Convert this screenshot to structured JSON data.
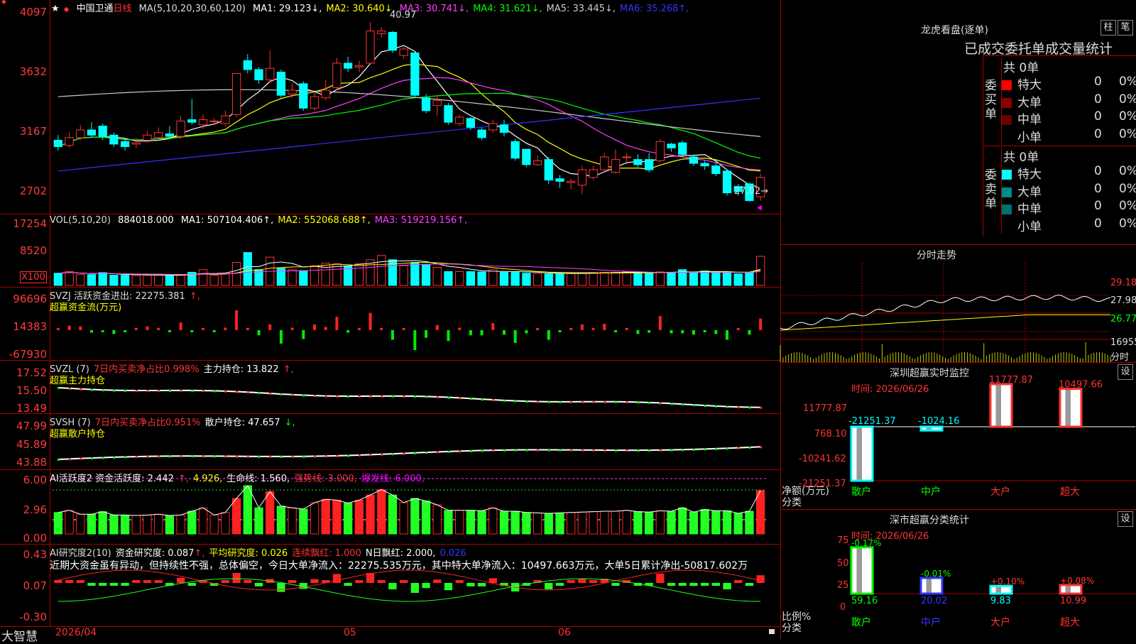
{
  "top_icons": {
    "left_glyph": "◆",
    "right_glyph": "◆"
  },
  "price_pane": {
    "stock": "中国卫通",
    "period": "日线",
    "ma_params": "MA(5,10,20,30,60,120)",
    "ma_values": [
      {
        "label": "MA1: 29.123",
        "arrow": "↓",
        "color": "#ffffff"
      },
      {
        "label": "MA2: 30.640",
        "arrow": "↓",
        "color": "#ffff00"
      },
      {
        "label": "MA3: 30.741",
        "arrow": "↓",
        "color": "#ff40ff"
      },
      {
        "label": "MA4: 31.621",
        "arrow": "↓",
        "color": "#00ff00"
      },
      {
        "label": "MA5: 33.445",
        "arrow": "↓",
        "color": "#cccccc"
      },
      {
        "label": "MA6: 35.268",
        "arrow": "↑",
        "color": "#3333ff"
      }
    ],
    "axis_labels": [
      "4097",
      "3632",
      "3167",
      "2702"
    ],
    "high_mark": "40.97",
    "low_mark": "27.02→"
  },
  "volume_pane": {
    "header": "VOL(5,10,20)",
    "value": "884018.000",
    "ma": [
      {
        "label": "MA1: 507104.406",
        "color": "#ffffff"
      },
      {
        "label": "MA2: 552068.688",
        "color": "#ffff00"
      },
      {
        "label": "MA3: 519219.156",
        "color": "#ff40ff"
      }
    ],
    "axis_labels": [
      "17254",
      "8520"
    ],
    "unit": "X100"
  },
  "svzj_pane": {
    "header": "SVZJ  活跃资金进出: 22275.381",
    "sub": "超赢资金流(万元)",
    "axis_labels": [
      "96696",
      "14383",
      "-67930"
    ]
  },
  "svzl_pane": {
    "header_a": "SVZL (7)",
    "header_b": "7日内买卖净占比0.998%",
    "header_c": "主力持仓: 13.822",
    "sub": "超赢主力持仓",
    "axis_labels": [
      "17.52",
      "15.50",
      "13.49"
    ]
  },
  "svsh_pane": {
    "header_a": "SVSH (7)",
    "header_b": "7日内买卖净占比0.951%",
    "header_c": "散户持仓: 47.657",
    "sub": "超赢散户持仓",
    "axis_labels": [
      "47.99",
      "45.89",
      "43.88"
    ]
  },
  "ai_active_pane": {
    "header_a": "AI活跃度2 资金活跃度: 2.442",
    "header_b": "4.926,",
    "header_c": "生命线: 1.560,",
    "header_d": "强势线: 3.000,",
    "header_e": "爆发线: 6.000,",
    "axis_labels": [
      "6.00",
      "2.96",
      "0.00"
    ]
  },
  "ai_research_pane": {
    "header_a": "AI研究度2(10)",
    "header_b": "资金研究度: 0.087",
    "header_c": "平均研究度: 0.026",
    "header_d": "连续飘红: 1.000",
    "header_e": "N日飘红: 2.000,",
    "header_f": "0.026",
    "comment": "近期大资金虽有异动，但持续性不强，总体偏空，今日大单净流入：22275.535万元，其中特大单净流入：10497.663万元，大单5日累计净出-50817.602万",
    "axis_labels": [
      "0.43",
      "0.07",
      "-0.30"
    ]
  },
  "bottom_bar": {
    "brand": "大智慧",
    "dates": [
      "2026/04",
      "05",
      "06"
    ]
  },
  "dragon_tiger": {
    "title": "龙虎看盘(逐单)",
    "btn1": "柱",
    "btn2": "笔",
    "table_title": "已成交委托单成交量统计",
    "buy_side_label": "委买单",
    "sell_side_label": "委卖单",
    "buy_total": "共 0单",
    "sell_total": "共 0单",
    "buy_rows": [
      {
        "label": "特大",
        "value": "0",
        "pct": "0%",
        "color": "#ff0000"
      },
      {
        "label": "大单",
        "value": "0",
        "pct": "0%",
        "color": "#8b0000"
      },
      {
        "label": "中单",
        "value": "0",
        "pct": "0%",
        "color": "#6b0000"
      },
      {
        "label": "小单",
        "value": "0",
        "pct": "0%",
        "color": "#000000"
      }
    ],
    "sell_rows": [
      {
        "label": "特大",
        "value": "0",
        "pct": "0%",
        "color": "#00ffff"
      },
      {
        "label": "大单",
        "value": "0",
        "pct": "0%",
        "color": "#008b8b"
      },
      {
        "label": "中单",
        "value": "0",
        "pct": "0%",
        "color": "#007070"
      },
      {
        "label": "小单",
        "value": "0",
        "pct": "0%",
        "color": "#000000"
      }
    ]
  },
  "intraday": {
    "title": "分时走势",
    "price_labels": [
      "29.18",
      "27.98",
      "26.77"
    ],
    "vol_label": "16955",
    "vol_unit": "分时"
  },
  "sz_monitor": {
    "title": "深圳超赢实时监控",
    "btn": "设",
    "time": "时间: 2026/06/26",
    "axis": [
      "11777.87",
      "768.10",
      "-10241.62",
      "-21251.37"
    ],
    "ylabel": "净额(万元)",
    "xlabel": "分类",
    "categories": [
      "散户",
      "中户",
      "大户",
      "超大"
    ],
    "values": [
      -21251.37,
      -1024.16,
      11777.87,
      10497.66
    ],
    "value_labels": [
      "-21251.37",
      "-1024.16",
      "11777.87",
      "10497.66"
    ]
  },
  "sz_classify": {
    "title": "深市超赢分类统计",
    "btn": "设",
    "time": "时间: 2026/06/26",
    "axis": [
      "75",
      "50",
      "25",
      "0"
    ],
    "ylabel": "比例%",
    "xlabel": "分类",
    "categories": [
      "散户",
      "中户",
      "大户",
      "超大"
    ],
    "values": [
      59.16,
      20.02,
      9.83,
      10.99
    ],
    "value_labels": [
      "59.16",
      "20.02",
      "9.83",
      "10.99"
    ],
    "changes": [
      "-0.17%",
      "-0.01%",
      "+0.10%",
      "+0.08%"
    ]
  },
  "chart_data": {
    "type": "candlestick",
    "candles": [
      [
        31.8,
        31.3,
        32.2,
        31.0
      ],
      [
        31.4,
        32.0,
        32.4,
        31.2
      ],
      [
        32.0,
        32.6,
        33.0,
        31.8
      ],
      [
        32.6,
        32.2,
        33.2,
        32.0
      ],
      [
        32.9,
        32.1,
        33.1,
        31.8
      ],
      [
        32.2,
        31.5,
        32.4,
        31.3
      ],
      [
        31.7,
        31.3,
        31.9,
        31.0
      ],
      [
        31.5,
        31.6,
        32.0,
        31.2
      ],
      [
        31.8,
        32.2,
        32.5,
        31.6
      ],
      [
        32.0,
        32.4,
        32.8,
        31.9
      ],
      [
        32.3,
        32.1,
        32.9,
        31.9
      ],
      [
        32.1,
        33.3,
        33.7,
        31.9
      ],
      [
        33.4,
        33.2,
        35.0,
        33.0
      ],
      [
        33.0,
        33.4,
        33.8,
        32.7
      ],
      [
        33.3,
        33.3,
        33.5,
        33.0
      ],
      [
        33.1,
        33.7,
        34.1,
        32.9
      ],
      [
        33.8,
        37.0,
        37.0,
        33.6
      ],
      [
        38.0,
        37.3,
        38.5,
        37.0
      ],
      [
        37.3,
        36.5,
        37.5,
        36.2
      ],
      [
        36.5,
        37.4,
        38.8,
        36.3
      ],
      [
        37.1,
        35.3,
        37.3,
        35.1
      ],
      [
        35.4,
        35.7,
        36.2,
        35.1
      ],
      [
        36.2,
        34.3,
        36.4,
        34.1
      ],
      [
        34.3,
        35.2,
        35.6,
        34.1
      ],
      [
        35.1,
        35.7,
        36.5,
        34.9
      ],
      [
        35.9,
        37.8,
        38.2,
        35.7
      ],
      [
        37.8,
        37.4,
        38.3,
        37.1
      ],
      [
        37.5,
        37.6,
        38.0,
        37.1
      ],
      [
        37.8,
        40.3,
        40.97,
        37.7
      ],
      [
        40.1,
        40.3,
        40.6,
        39.8
      ],
      [
        40.2,
        38.8,
        40.3,
        38.6
      ],
      [
        38.4,
        38.9,
        39.1,
        38.1
      ],
      [
        38.6,
        35.3,
        38.7,
        35.1
      ],
      [
        35.1,
        34.1,
        35.4,
        33.9
      ],
      [
        34.5,
        34.9,
        35.3,
        33.7
      ],
      [
        34.5,
        33.2,
        34.7,
        33.0
      ],
      [
        33.1,
        33.6,
        33.8,
        32.9
      ],
      [
        33.5,
        32.8,
        33.6,
        32.6
      ],
      [
        32.6,
        32.0,
        32.8,
        31.8
      ],
      [
        32.6,
        33.1,
        33.4,
        32.4
      ],
      [
        33.0,
        32.4,
        33.4,
        32.1
      ],
      [
        31.7,
        30.4,
        31.9,
        30.2
      ],
      [
        31.1,
        29.9,
        31.1,
        29.7
      ],
      [
        29.9,
        30.2,
        30.6,
        29.8
      ],
      [
        30.3,
        28.7,
        30.5,
        28.4
      ],
      [
        28.8,
        28.6,
        29.1,
        28.1
      ],
      [
        28.5,
        28.6,
        28.8,
        28.0
      ],
      [
        28.3,
        29.5,
        29.8,
        27.6
      ],
      [
        28.9,
        29.5,
        29.8,
        28.7
      ],
      [
        29.5,
        30.5,
        30.8,
        29.4
      ],
      [
        29.3,
        30.3,
        31.1,
        29.2
      ],
      [
        30.5,
        30.5,
        30.8,
        29.9
      ],
      [
        30.3,
        29.9,
        30.7,
        29.7
      ],
      [
        30.3,
        29.5,
        30.8,
        29.3
      ],
      [
        30.2,
        31.7,
        31.9,
        30.1
      ],
      [
        31.5,
        31.2,
        31.6,
        30.9
      ],
      [
        31.6,
        30.7,
        31.8,
        30.5
      ],
      [
        30.5,
        30.0,
        30.7,
        29.8
      ],
      [
        30.0,
        29.8,
        30.2,
        29.5
      ],
      [
        29.8,
        29.2,
        30.1,
        29.0
      ],
      [
        29.4,
        27.7,
        29.5,
        27.5
      ],
      [
        28.2,
        27.8,
        28.4,
        27.5
      ],
      [
        28.4,
        27.1,
        28.5,
        27.02
      ],
      [
        27.4,
        28.9,
        29.2,
        27.1
      ]
    ],
    "volume": [
      370,
      420,
      330,
      330,
      390,
      310,
      310,
      300,
      310,
      330,
      300,
      310,
      400,
      480,
      310,
      370,
      700,
      1000,
      480,
      860,
      520,
      480,
      450,
      600,
      680,
      660,
      590,
      660,
      780,
      910,
      780,
      600,
      700,
      640,
      550,
      420,
      420,
      420,
      410,
      480,
      400,
      400,
      370,
      360,
      350,
      360,
      370,
      380,
      390,
      400,
      400,
      420,
      390,
      380,
      410,
      400,
      480,
      380,
      440,
      410,
      410,
      350,
      400,
      884
    ],
    "volume_ylim": [
      0,
      1725
    ],
    "price_ylim": [
      27.02,
      40.97
    ]
  }
}
